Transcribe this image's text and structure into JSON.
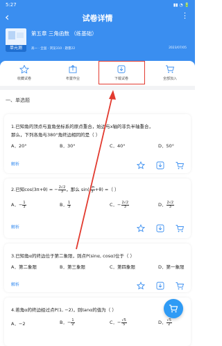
{
  "status": {
    "time": "5:27",
    "icons": "▮▮ ◔ 🔋"
  },
  "nav": {
    "back_icon": "‹",
    "title": "试卷详情",
    "more_icon": "⋮"
  },
  "paper": {
    "cover_label": "单元测",
    "title": "第五章 三角函数 （练基础）",
    "meta": "高一 · 全国 · 浏览310 · 题量22",
    "date": "2023/07/05"
  },
  "actions": [
    {
      "label": "收藏试卷",
      "icon": "star-icon"
    },
    {
      "label": "布置作业",
      "icon": "share-icon"
    },
    {
      "label": "下载试卷",
      "icon": "download-icon"
    },
    {
      "label": "全部加入",
      "icon": "cart-icon"
    }
  ],
  "section": {
    "title": "一、单选题"
  },
  "questions": [
    {
      "line1": "1.已知角的顶点与直角坐标系的原点重合，始边与x轴的非负半轴重合，",
      "line2": "那么，下列各角与380°角终边相同的是（   ）",
      "options": [
        "A．20°",
        "B．30°",
        "C．40°",
        "D．50°"
      ],
      "analysis": "解析"
    },
    {
      "line1": "2.已知 cos(3π+θ) = −2√2/3，那么 sin(2π/3+θ) =（   ）",
      "line1a": "2.已知",
      "line1b": "cos(3π+θ) = −",
      "line1c": "2√2",
      "line1d": "3",
      "line1e": "，那么 sin(",
      "line1f": "2π",
      "line1g": "3",
      "line1h": "+θ) =（   ）",
      "options": [
        "A．−",
        "B．",
        "C．−",
        "D．"
      ],
      "opt_fracs": [
        [
          "1",
          "3"
        ],
        [
          "1",
          "3"
        ],
        [
          "2√2",
          "3"
        ],
        [
          "2√2",
          "3"
        ]
      ],
      "analysis": "解析"
    },
    {
      "line1": "3.已知角α的终边位于第二象限，则点P(sinα, cosα)位于（   ）",
      "options": [
        "A．第二象限",
        "B．第三象限",
        "C．第四象限",
        "D．第一象限"
      ],
      "analysis": "解析"
    },
    {
      "line1": "4.若角α的终边经过点P(1, −2)，则tanα的值为（   ）",
      "options": [
        "A．−2",
        "B．−",
        "C．−",
        "D．"
      ],
      "opt_fracs": [
        [],
        [
          "1",
          "2"
        ],
        [
          "√5",
          "5"
        ],
        [
          "√5",
          "2"
        ]
      ]
    }
  ],
  "colors": {
    "accent": "#3a8ef0",
    "highlight": "#e23a2f",
    "fab": "#2f9bf5"
  }
}
